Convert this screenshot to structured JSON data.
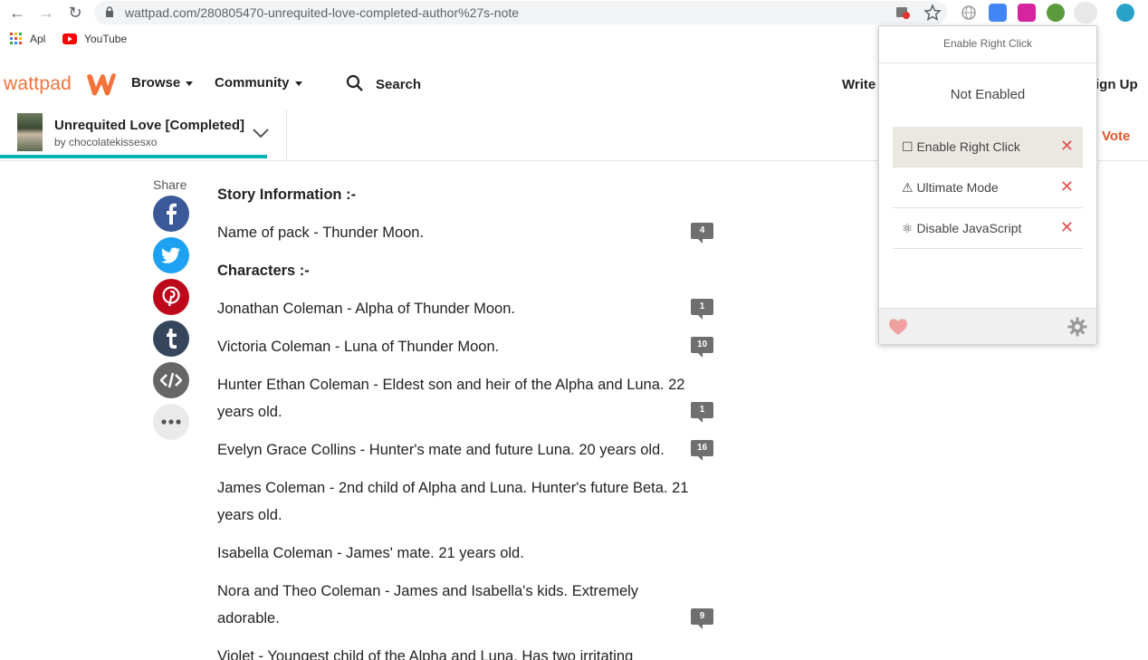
{
  "browser": {
    "url": "wattpad.com/280805470-unrequited-love-completed-author%27s-note",
    "bookmarks": [
      {
        "label": "Apl"
      },
      {
        "label": "YouTube"
      }
    ]
  },
  "header": {
    "logo_text": "wattpad",
    "nav": {
      "browse": "Browse",
      "community": "Community",
      "search": "Search",
      "write": "Write",
      "signup": "ign Up"
    }
  },
  "story": {
    "title": "Unrequited Love [Completed]",
    "author": "by chocolatekissesxo",
    "vote_label": "Vote",
    "progress_fraction": 0.233
  },
  "share": {
    "label": "Share"
  },
  "content": {
    "paragraphs": [
      {
        "text": "Story Information :-",
        "bold": true,
        "comments": ""
      },
      {
        "text": "Name of pack - Thunder Moon.",
        "bold": false,
        "comments": "4"
      },
      {
        "text": "Characters :-",
        "bold": true,
        "comments": ""
      },
      {
        "text": "Jonathan Coleman - Alpha of Thunder Moon.",
        "bold": false,
        "comments": "1"
      },
      {
        "text": "Victoria Coleman - Luna of Thunder Moon.",
        "bold": false,
        "comments": "10"
      },
      {
        "text": "Hunter Ethan Coleman - Eldest son and heir of the Alpha and Luna. 22 years old.",
        "bold": false,
        "comments": "1"
      },
      {
        "text": "Evelyn Grace Collins - Hunter's mate and future Luna. 20 years old.",
        "bold": false,
        "comments": "16"
      },
      {
        "text": "James Coleman - 2nd child of Alpha and Luna. Hunter's future Beta. 21 years old.",
        "bold": false,
        "comments": ""
      },
      {
        "text": "Isabella Coleman - James' mate. 21 years old.",
        "bold": false,
        "comments": ""
      },
      {
        "text": "Nora and Theo Coleman - James and Isabella's kids. Extremely adorable.",
        "bold": false,
        "comments": "9"
      },
      {
        "text": "Violet - Youngest child of the Alpha and Luna. Has two irritating",
        "bold": false,
        "comments": ""
      }
    ]
  },
  "popup": {
    "title": "Enable Right Click",
    "status": "Not Enabled",
    "options": [
      {
        "label": "☐ Enable Right Click"
      },
      {
        "label": "⚠ Ultimate Mode"
      },
      {
        "label": "⚛ Disable JavaScript"
      }
    ],
    "close_glyph": "✕"
  },
  "colors": {
    "brand": "#f4733c",
    "progress": "#00b2b2",
    "vote": "#e0552c",
    "facebook": "#3b5998",
    "twitter": "#1da1f2",
    "pinterest": "#bd081c",
    "tumblr": "#35465c",
    "embed": "#666666"
  },
  "icons": [
    "back-arrow-icon",
    "forward-arrow-icon",
    "reload-icon",
    "lock-icon",
    "star-icon",
    "apps-grid-icon",
    "youtube-icon",
    "search-icon",
    "chevron-down-icon",
    "facebook-icon",
    "twitter-icon",
    "pinterest-icon",
    "tumblr-icon",
    "embed-code-icon",
    "more-icon",
    "comment-bubble-icon",
    "heart-icon",
    "gear-icon",
    "close-icon"
  ]
}
